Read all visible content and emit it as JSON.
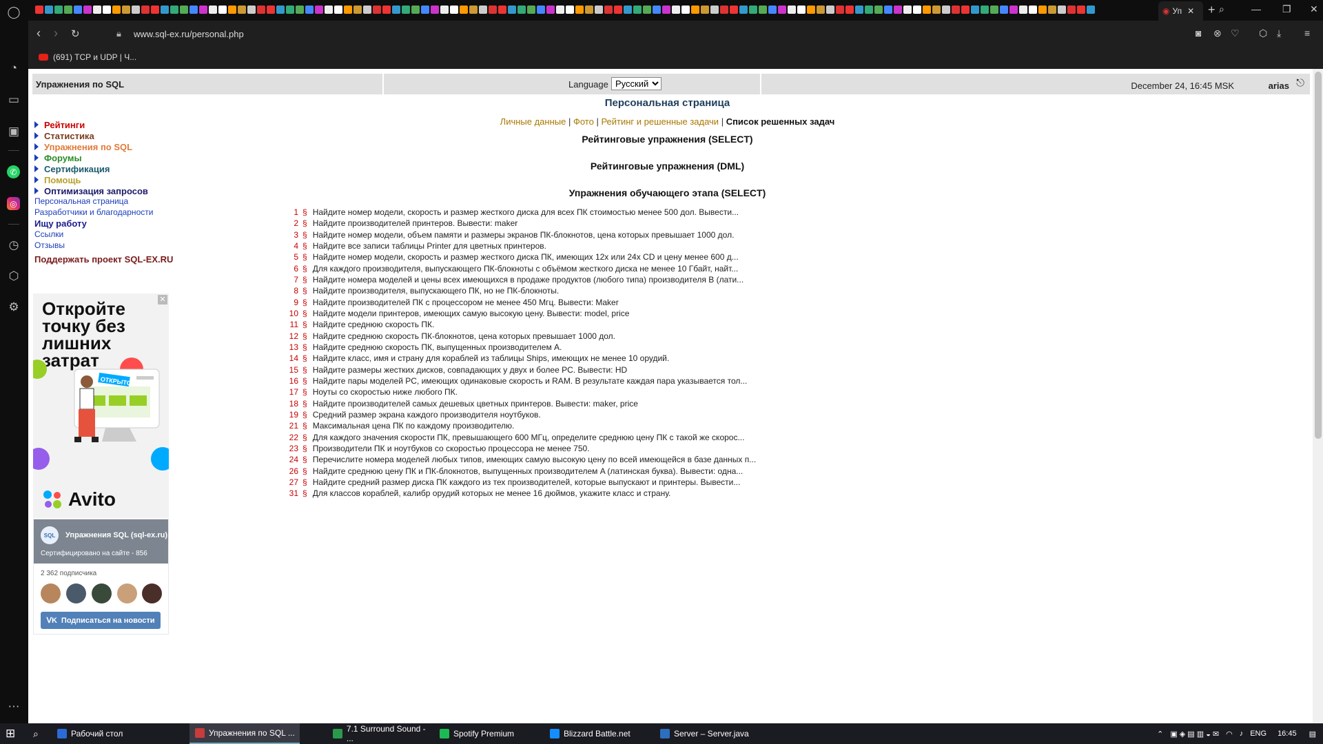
{
  "browser": {
    "url": "www.sql-ex.ru/personal.php",
    "active_tab_label": "Уп",
    "bookmark_label": "(691) TCP и UDP | Ч..."
  },
  "header": {
    "site_title": "Упражнения по SQL",
    "language_label": "Language",
    "language_value": "Русский",
    "datetime": "December 24, 16:45 MSK",
    "username": "arias"
  },
  "nav": {
    "items": [
      {
        "label": "Рейтинги",
        "color": "#cc0000"
      },
      {
        "label": "Статистика",
        "color": "#7a3b1b"
      },
      {
        "label": "Упражнения по SQL",
        "color": "#e07b39"
      },
      {
        "label": "Форумы",
        "color": "#2a8c2a"
      },
      {
        "label": "Сертификация",
        "color": "#1b5a6b"
      },
      {
        "label": "Помощь",
        "color": "#b8a02a"
      },
      {
        "label": "Оптимизация запросов",
        "color": "#1b1b6b"
      }
    ],
    "links": [
      "Персональная страница",
      "Разработчики и благодарности"
    ],
    "job": "Ищу работу",
    "links2": [
      "Ссылки",
      "Отзывы"
    ],
    "support": "Поддержать проект SQL-EX.RU"
  },
  "ad": {
    "headline": "Откройте точку без лишних затрат",
    "badge": "ОТКРЫТО",
    "brand": "Avito"
  },
  "vk": {
    "group_name": "Упражнения SQL (sql-ex.ru)",
    "group_sub": "Сертифицировано на сайте - 856",
    "avatar_text": "SQL",
    "subscribers": "2 362 подписчика",
    "subscribe_label": "Подписаться на новости"
  },
  "main": {
    "title": "Персональная страница",
    "tab_links": [
      "Личные данные",
      "Фото",
      "Рейтинг и решенные задачи"
    ],
    "tab_current": "Список решенных задач",
    "sections": [
      "Рейтинговые упражнения (SELECT)",
      "Рейтинговые упражнения (DML)",
      "Упражнения обучающего этапа (SELECT)"
    ],
    "tasks": [
      {
        "n": "1",
        "text": "Найдите номер модели, скорость и размер жесткого диска для всех ПК стоимостью менее 500 дол. Вывести..."
      },
      {
        "n": "2",
        "text": "Найдите производителей принтеров. Вывести: maker"
      },
      {
        "n": "3",
        "text": "Найдите номер модели, объем памяти и размеры экранов ПК-блокнотов, цена которых превышает 1000 дол."
      },
      {
        "n": "4",
        "text": "Найдите все записи таблицы Printer для цветных принтеров."
      },
      {
        "n": "5",
        "text": "Найдите номер модели, скорость и размер жесткого диска ПК, имеющих 12x или 24x CD и цену менее 600 д..."
      },
      {
        "n": "6",
        "text": "Для каждого производителя, выпускающего ПК-блокноты с объёмом жесткого диска не менее 10 Гбайт, найт..."
      },
      {
        "n": "7",
        "text": "Найдите номера моделей и цены всех имеющихся в продаже продуктов (любого типа) производителя B (лати..."
      },
      {
        "n": "8",
        "text": "Найдите производителя, выпускающего ПК, но не ПК-блокноты."
      },
      {
        "n": "9",
        "text": "Найдите производителей ПК с процессором не менее 450 Мгц. Вывести: Maker"
      },
      {
        "n": "10",
        "text": "Найдите модели принтеров, имеющих самую высокую цену. Вывести: model, price"
      },
      {
        "n": "11",
        "text": "Найдите среднюю скорость ПК."
      },
      {
        "n": "12",
        "text": "Найдите среднюю скорость ПК-блокнотов, цена которых превышает 1000 дол."
      },
      {
        "n": "13",
        "text": "Найдите среднюю скорость ПК, выпущенных производителем А."
      },
      {
        "n": "14",
        "text": "Найдите класс, имя и страну для кораблей из таблицы Ships, имеющих не менее 10 орудий."
      },
      {
        "n": "15",
        "text": "Найдите размеры жестких дисков, совпадающих у двух и более PC. Вывести: HD"
      },
      {
        "n": "16",
        "text": "Найдите пары моделей PC, имеющих одинаковые скорость и RAM. В результате каждая пара указывается тол..."
      },
      {
        "n": "17",
        "text": "Ноуты со скоростью ниже любого ПК."
      },
      {
        "n": "18",
        "text": "Найдите производителей самых дешевых цветных принтеров. Вывести: maker, price"
      },
      {
        "n": "19",
        "text": "Средний размер экрана каждого производителя ноутбуков."
      },
      {
        "n": "21",
        "text": "Максимальная цена ПК по каждому производителю."
      },
      {
        "n": "22",
        "text": "Для каждого значения скорости ПК, превышающего 600 МГц, определите среднюю цену ПК с такой же скорос..."
      },
      {
        "n": "23",
        "text": "Производители ПК и ноутбуков со скоростью процессора не менее 750."
      },
      {
        "n": "24",
        "text": "Перечислите номера моделей любых типов, имеющих самую высокую цену по всей имеющейся в базе данных п..."
      },
      {
        "n": "26",
        "text": "Найдите среднюю цену ПК и ПК-блокнотов, выпущенных производителем A (латинская буква). Вывести: одна..."
      },
      {
        "n": "27",
        "text": "Найдите средний размер диска ПК каждого из тех производителей, которые выпускают и принтеры. Вывести..."
      },
      {
        "n": "31",
        "text": "Для классов кораблей, калибр орудий которых не менее 16 дюймов, укажите класс и страну."
      }
    ]
  },
  "taskbar": {
    "items": [
      "Рабочий стол",
      "Упражнения по SQL ...",
      "7.1 Surround Sound - ...",
      "Spotify Premium",
      "Blizzard Battle.net",
      "Server – Server.java"
    ],
    "lang": "ENG",
    "time": "16:45"
  }
}
